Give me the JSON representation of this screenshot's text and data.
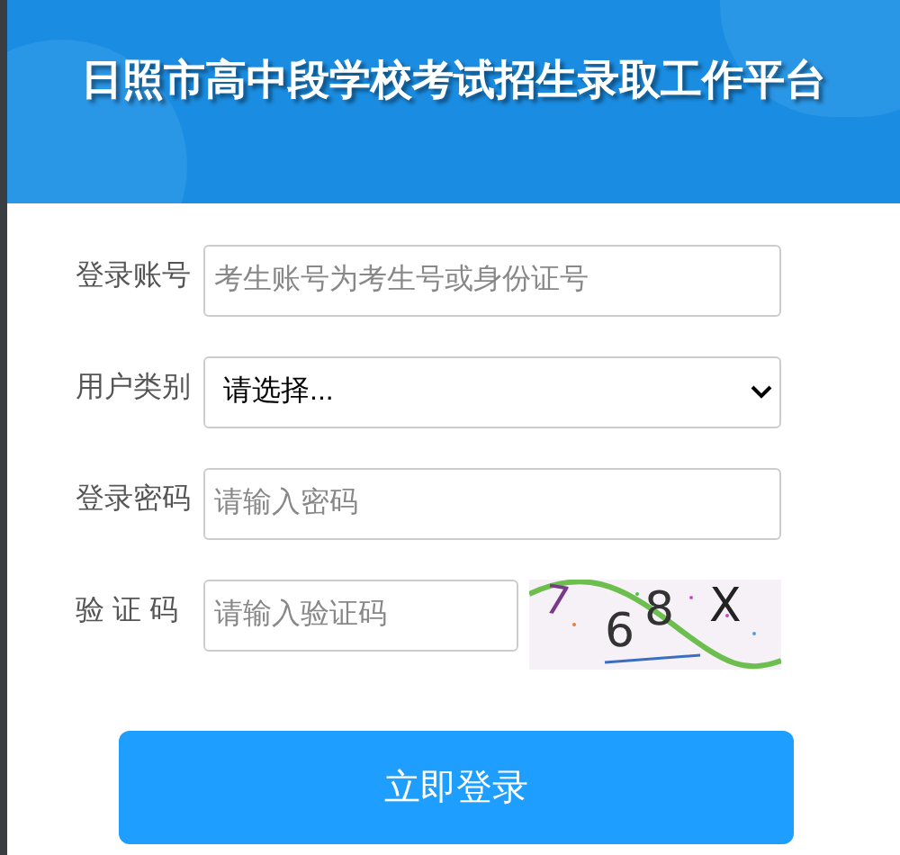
{
  "header": {
    "title": "日照市高中段学校考试招生录取工作平台"
  },
  "form": {
    "fields": [
      {
        "kind": "text",
        "label": "登录账号",
        "placeholder": "考生账号为考生号或身份证号"
      },
      {
        "kind": "select",
        "label": "用户类别",
        "value": "请选择..."
      },
      {
        "kind": "password",
        "label": "登录密码",
        "placeholder": "请输入密码"
      },
      {
        "kind": "captcha",
        "label": "验 证 码",
        "placeholder": "请输入验证码",
        "captcha": [
          "7",
          "6",
          "8",
          "X"
        ]
      }
    ],
    "submit": "立即登录"
  }
}
